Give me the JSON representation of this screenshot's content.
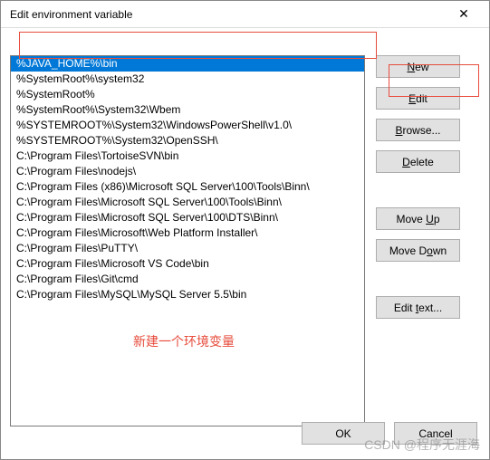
{
  "window": {
    "title": "Edit environment variable",
    "close": "✕"
  },
  "list": {
    "items": [
      "%JAVA_HOME%\\bin",
      "%SystemRoot%\\system32",
      "%SystemRoot%",
      "%SystemRoot%\\System32\\Wbem",
      "%SYSTEMROOT%\\System32\\WindowsPowerShell\\v1.0\\",
      "%SYSTEMROOT%\\System32\\OpenSSH\\",
      "C:\\Program Files\\TortoiseSVN\\bin",
      "C:\\Program Files\\nodejs\\",
      "C:\\Program Files (x86)\\Microsoft SQL Server\\100\\Tools\\Binn\\",
      "C:\\Program Files\\Microsoft SQL Server\\100\\Tools\\Binn\\",
      "C:\\Program Files\\Microsoft SQL Server\\100\\DTS\\Binn\\",
      "C:\\Program Files\\Microsoft\\Web Platform Installer\\",
      "C:\\Program Files\\PuTTY\\",
      "C:\\Program Files\\Microsoft VS Code\\bin",
      "C:\\Program Files\\Git\\cmd",
      "C:\\Program Files\\MySQL\\MySQL Server 5.5\\bin"
    ],
    "selected_index": 0
  },
  "buttons": {
    "new": "New",
    "edit": "Edit",
    "browse": "Browse...",
    "delete": "Delete",
    "move_up": "Move Up",
    "move_down": "Move Down",
    "edit_text": "Edit text...",
    "ok": "OK",
    "cancel": "Cancel"
  },
  "annotation": "新建一个环境变量",
  "watermark": "CSDN @程序无涯海"
}
